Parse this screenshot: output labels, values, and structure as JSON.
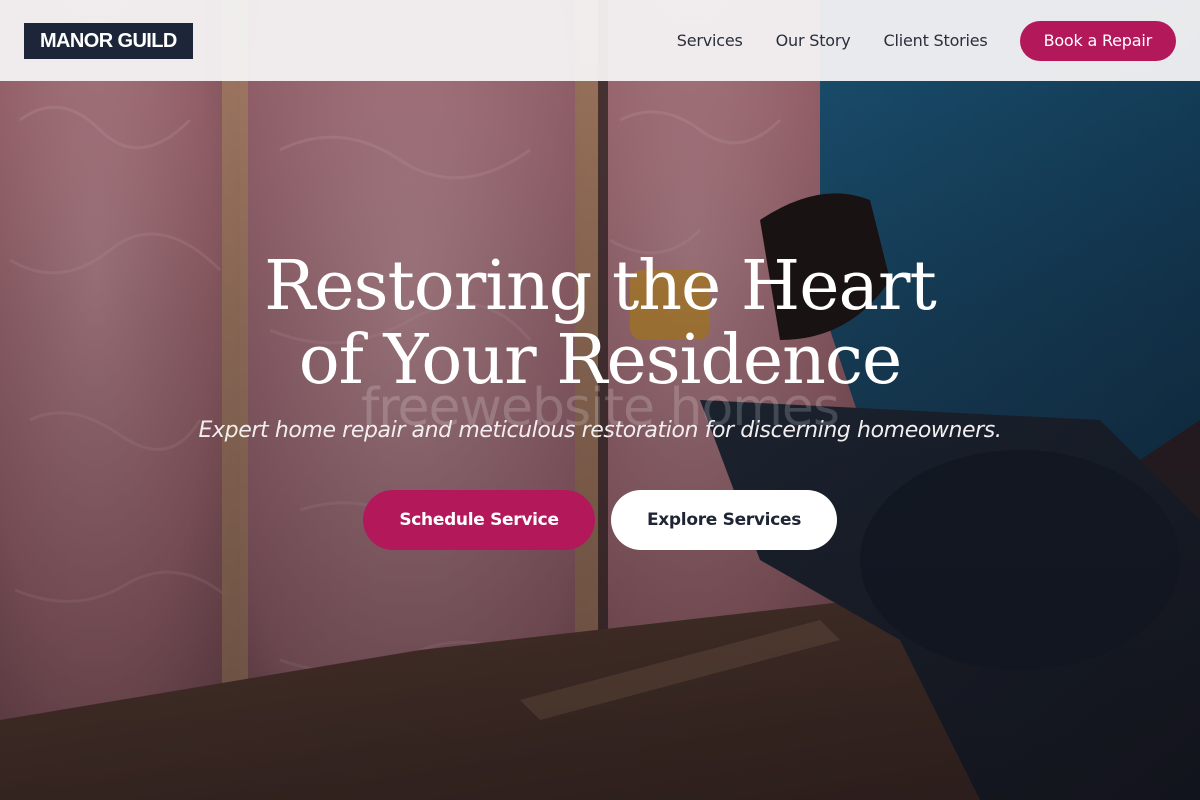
{
  "header": {
    "logo": "MANOR GUILD",
    "nav": [
      "Services",
      "Our Story",
      "Client Stories"
    ],
    "cta": "Book a Repair"
  },
  "hero": {
    "headline_line1": "Restoring the Heart",
    "headline_line2": "of Your Residence",
    "watermark": "freewebsite homes",
    "tagline": "Expert home repair and meticulous restoration for discerning homeowners.",
    "primary_cta": "Schedule Service",
    "secondary_cta": "Explore Services"
  },
  "colors": {
    "brand": "#b3185b",
    "logo_bg": "#1d2638",
    "header_bg": "#f5f4f5"
  }
}
